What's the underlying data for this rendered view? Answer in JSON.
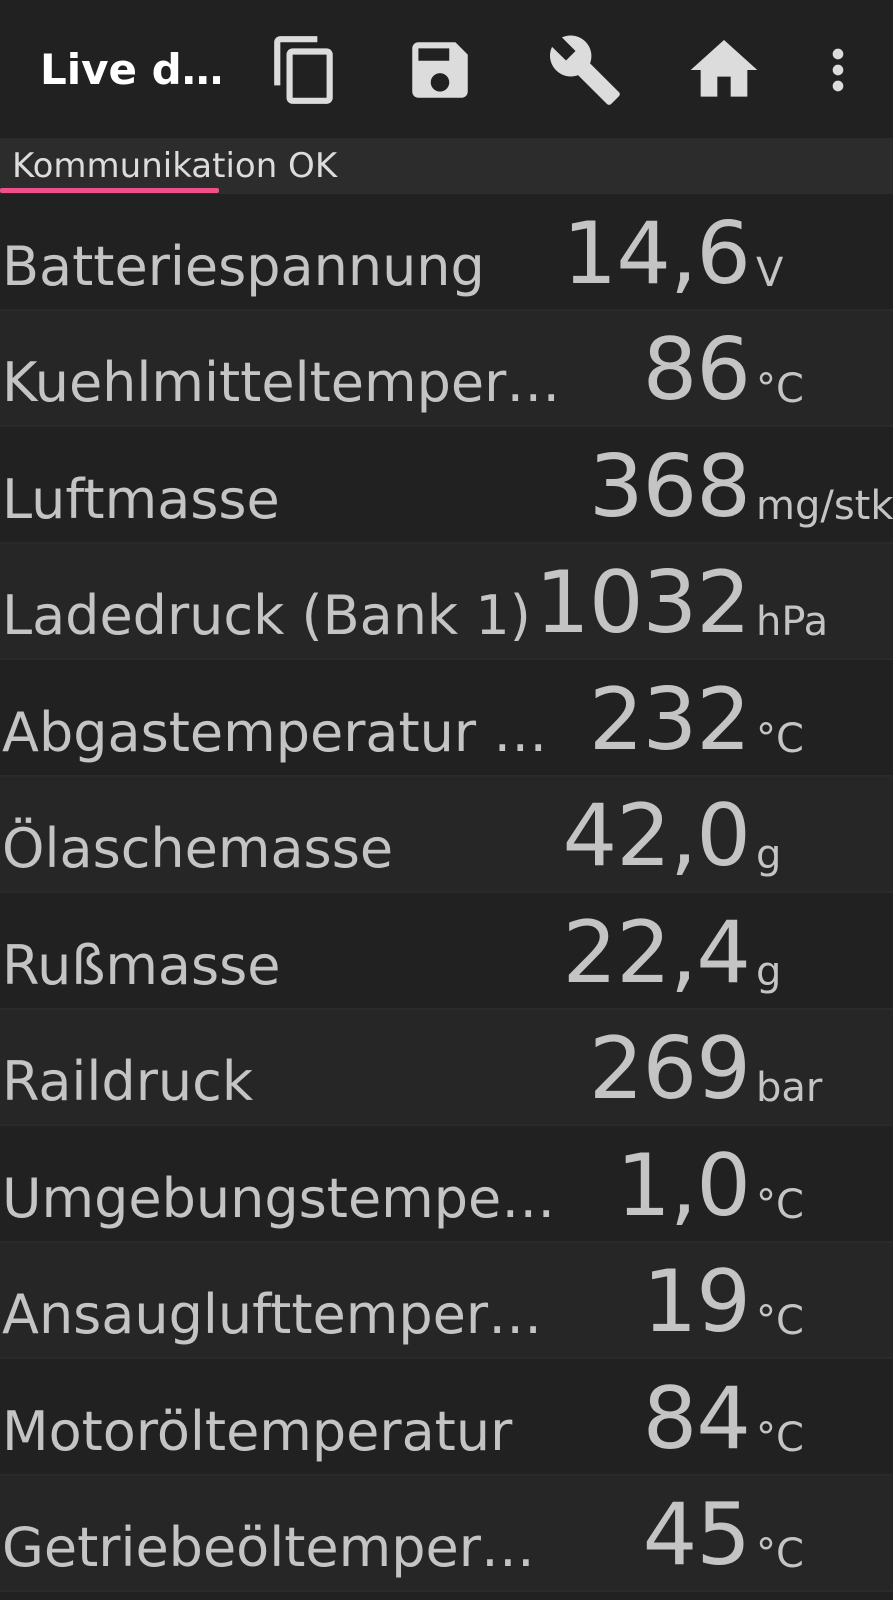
{
  "toolbar": {
    "title": "Live d…",
    "icons": [
      "copy-icon",
      "save-icon",
      "wrench-icon",
      "home-icon",
      "more-vert-icon"
    ]
  },
  "status": {
    "text": "Kommunikation OK",
    "progress_fraction": 0.245,
    "progress_color": "#f0508a"
  },
  "rows": [
    {
      "label": "Batteriespannung",
      "value": "14,6",
      "unit": "V"
    },
    {
      "label": "Kuehlmitteltemperatur",
      "value": "86",
      "unit": "°C"
    },
    {
      "label": "Luftmasse",
      "value": "368",
      "unit": "mg/stk"
    },
    {
      "label": "Ladedruck (Bank 1)",
      "value": "1032",
      "unit": "hPa"
    },
    {
      "label": "Abgastemperatur (Ba…",
      "value": "232",
      "unit": "°C"
    },
    {
      "label": "Ölaschemasse",
      "value": "42,0",
      "unit": "g"
    },
    {
      "label": "Rußmasse",
      "value": "22,4",
      "unit": "g"
    },
    {
      "label": "Raildruck",
      "value": "269",
      "unit": "bar"
    },
    {
      "label": "Umgebungstemperatur",
      "value": "1,0",
      "unit": "°C"
    },
    {
      "label": "Ansauglufttemperatur",
      "value": "19",
      "unit": "°C"
    },
    {
      "label": "Motoröltemperatur",
      "value": "84",
      "unit": "°C"
    },
    {
      "label": "Getriebeöltemperatur",
      "value": "45",
      "unit": "°C"
    }
  ]
}
